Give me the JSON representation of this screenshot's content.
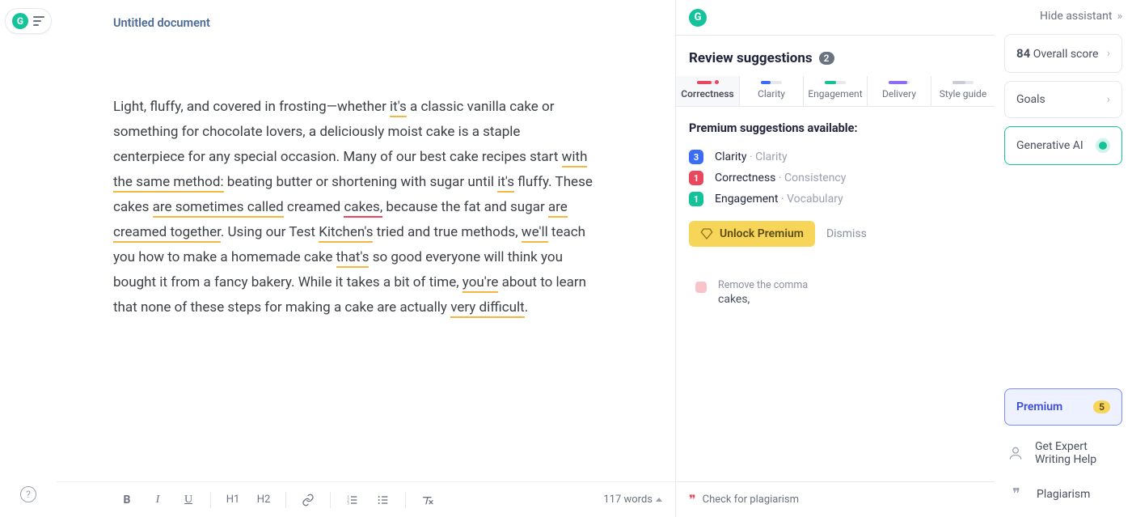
{
  "doc": {
    "title": "Untitled document",
    "body_segments": [
      {
        "t": "Light, fluffy, and covered in frosting—whether "
      },
      {
        "t": "it's",
        "u": "orange"
      },
      {
        "t": " a classic vanilla cake or something for chocolate lovers, a deliciously moist cake is a staple centerpiece for any special occasion. Many of our best cake recipes start "
      },
      {
        "t": "with the same method:",
        "u": "orange"
      },
      {
        "t": " beating butter or shortening with sugar until "
      },
      {
        "t": "it's",
        "u": "orange"
      },
      {
        "t": " fluffy. These cakes "
      },
      {
        "t": "are sometimes called",
        "u": "orange"
      },
      {
        "t": " creamed "
      },
      {
        "t": "cakes,",
        "u": "red"
      },
      {
        "t": " because the fat and sugar "
      },
      {
        "t": "are creamed together",
        "u": "orange"
      },
      {
        "t": ". Using our Test "
      },
      {
        "t": "Kitchen's",
        "u": "orange"
      },
      {
        "t": " tried and true methods, "
      },
      {
        "t": "we'll",
        "u": "orange"
      },
      {
        "t": " teach you how to make a homemade cake "
      },
      {
        "t": "that's",
        "u": "orange"
      },
      {
        "t": " so good everyone will think you bought it from a fancy bakery. While it takes a bit of time, "
      },
      {
        "t": "you're",
        "u": "orange"
      },
      {
        "t": " about to learn that none of these steps for making a cake are actually "
      },
      {
        "t": "very difficult",
        "u": "orange"
      },
      {
        "t": "."
      }
    ],
    "word_count_label": "117 words"
  },
  "toolbar": {
    "bold": "B",
    "italic": "I",
    "underline": "U",
    "h1": "H1",
    "h2": "H2",
    "link": "🔗",
    "num_list": "≣",
    "bul_list": "•",
    "clear": "✗"
  },
  "panel": {
    "header": "Review suggestions",
    "count": "2",
    "tabs": [
      {
        "key": "correctness",
        "label": "Correctness",
        "bar": "red",
        "active": true
      },
      {
        "key": "clarity",
        "label": "Clarity",
        "bar": "blue"
      },
      {
        "key": "engagement",
        "label": "Engagement",
        "bar": "green"
      },
      {
        "key": "delivery",
        "label": "Delivery",
        "bar": "purple"
      },
      {
        "key": "styleguide",
        "label": "Style guide",
        "bar": "grey"
      }
    ],
    "premium_title": "Premium suggestions available:",
    "premium_items": [
      {
        "count": "3",
        "color": "blue",
        "cat": "Clarity",
        "sub": "Clarity"
      },
      {
        "count": "1",
        "color": "red",
        "cat": "Correctness",
        "sub": "Consistency"
      },
      {
        "count": "1",
        "color": "green",
        "cat": "Engagement",
        "sub": "Vocabulary"
      }
    ],
    "unlock_label": "Unlock Premium",
    "dismiss_label": "Dismiss",
    "card": {
      "title": "Remove the comma",
      "snippet": "cakes,"
    },
    "plagiarism_label": "Check for plagiarism"
  },
  "rail": {
    "hide_label": "Hide assistant",
    "score_value": "84",
    "score_label": "Overall score",
    "goals_label": "Goals",
    "gen_ai_label": "Generative AI",
    "premium_label": "Premium",
    "premium_count": "5",
    "expert_label": "Get Expert Writing Help",
    "plag_label": "Plagiarism"
  }
}
